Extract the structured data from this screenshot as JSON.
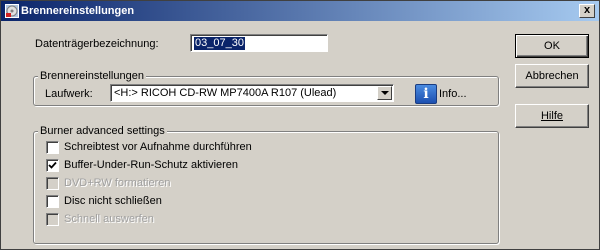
{
  "window": {
    "title": "Brennereinstellungen",
    "close_label": "x"
  },
  "volume_label": {
    "label": "Datenträgerbezeichnung:",
    "value": "03_07_30"
  },
  "buttons": {
    "ok": "OK",
    "abbrechen": "Abbrechen",
    "hilfe": "Hilfe"
  },
  "burner_group": {
    "title": "Brennereinstellungen",
    "drive_label": "Laufwerk:",
    "drive_value": "<H:>  RICOH CD-RW MP7400A  R107 (Ulead)",
    "info_label": "Info..."
  },
  "advanced_group": {
    "title": "Burner advanced settings",
    "options": [
      {
        "label": "Schreibtest vor Aufnahme durchführen",
        "checked": false,
        "enabled": true
      },
      {
        "label": "Buffer-Under-Run-Schutz aktivieren",
        "checked": true,
        "enabled": true
      },
      {
        "label": "DVD+RW formatieren",
        "checked": false,
        "enabled": false
      },
      {
        "label": "Disc nicht schließen",
        "checked": false,
        "enabled": true
      },
      {
        "label": "Schnell auswerfen",
        "checked": false,
        "enabled": false
      }
    ]
  },
  "colors": {
    "titlebar_start": "#0a246a",
    "titlebar_end": "#a6caf0",
    "dialog_bg": "#d4d0c8"
  }
}
